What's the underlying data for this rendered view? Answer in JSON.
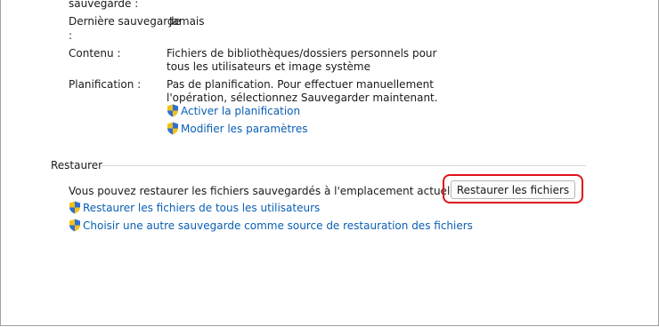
{
  "backup": {
    "prev_label_tail": "sauvegarde :",
    "last_backup_label": "Dernière sauvegarde",
    "last_backup_colon": ":",
    "last_backup_value": "Jamais",
    "content_label": "Contenu :",
    "content_value_line1": "Fichiers de bibliothèques/dossiers personnels pour",
    "content_value_line2": "tous les utilisateurs et image système",
    "schedule_label": "Planification :",
    "schedule_value_line1": "Pas de planification. Pour effectuer manuellement",
    "schedule_value_line2": "l'opération, sélectionnez Sauvegarder maintenant.",
    "enable_schedule_link": "Activer la planification",
    "modify_settings_link": "Modifier les paramètres"
  },
  "restore": {
    "section_title": "Restaurer",
    "description": "Vous pouvez restaurer les fichiers sauvegardés à l'emplacement actuel.",
    "restore_button": "Restaurer les fichiers",
    "restore_all_users_link": "Restaurer les fichiers de tous les utilisateurs",
    "choose_other_backup_link": "Choisir une autre sauvegarde comme source de restauration des fichiers"
  },
  "colors": {
    "link": "#0a5fb4",
    "highlight": "#e0121a"
  },
  "icons": {
    "uac_shield": "uac-shield-icon"
  }
}
